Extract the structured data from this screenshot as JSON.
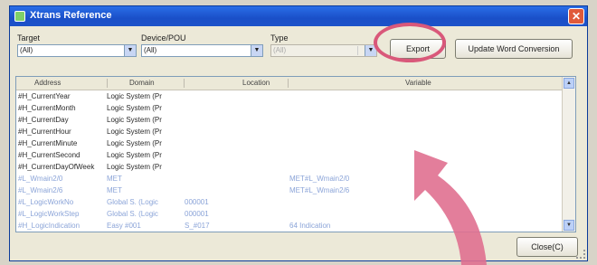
{
  "window": {
    "title": "Xtrans Reference"
  },
  "filters": {
    "target_label": "Target",
    "target_value": "(All)",
    "device_label": "Device/POU",
    "device_value": "(All)",
    "type_label": "Type",
    "type_value": "(All)"
  },
  "buttons": {
    "export": "Export",
    "update_word": "Update Word Conversion",
    "close": "Close(C)"
  },
  "table": {
    "columns": [
      "Address",
      "Domain",
      "Location",
      "Variable"
    ],
    "rows": [
      {
        "address": "#H_CurrentYear",
        "domain": "Logic System (Pr",
        "location": "",
        "variable": "",
        "style": "dark"
      },
      {
        "address": "#H_CurrentMonth",
        "domain": "Logic System (Pr",
        "location": "",
        "variable": "",
        "style": "dark"
      },
      {
        "address": "#H_CurrentDay",
        "domain": "Logic System (Pr",
        "location": "",
        "variable": "",
        "style": "dark"
      },
      {
        "address": "#H_CurrentHour",
        "domain": "Logic System (Pr",
        "location": "",
        "variable": "",
        "style": "dark"
      },
      {
        "address": "#H_CurrentMinute",
        "domain": "Logic System (Pr",
        "location": "",
        "variable": "",
        "style": "dark"
      },
      {
        "address": "#H_CurrentSecond",
        "domain": "Logic System (Pr",
        "location": "",
        "variable": "",
        "style": "dark"
      },
      {
        "address": "#H_CurrentDayOfWeek",
        "domain": "Logic System (Pr",
        "location": "",
        "variable": "",
        "style": "dark"
      },
      {
        "address": "#L_Wmain2/0",
        "domain": "MET",
        "location": "",
        "variable": "MET#L_Wmain2/0",
        "style": "dim"
      },
      {
        "address": "#L_Wmain2/6",
        "domain": "MET",
        "location": "",
        "variable": "MET#L_Wmain2/6",
        "style": "dim"
      },
      {
        "address": "#L_LogicWorkNo",
        "domain": "Global S. (Logic",
        "location": "000001",
        "variable": "",
        "style": "dim"
      },
      {
        "address": "#L_LogicWorkStep",
        "domain": "Global S. (Logic",
        "location": "000001",
        "variable": "",
        "style": "dim"
      },
      {
        "address": "#H_LogicIndication",
        "domain": "Easy #001",
        "location": "S_#017",
        "variable": "64 Indication",
        "style": "dim"
      }
    ]
  }
}
